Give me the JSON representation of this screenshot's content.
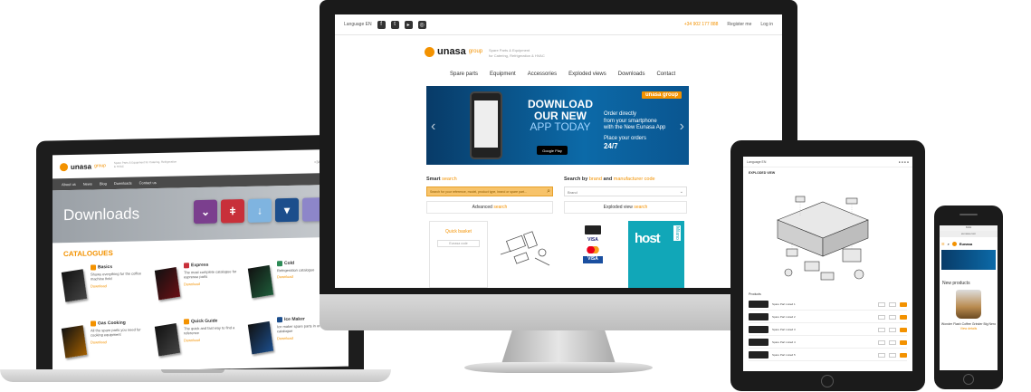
{
  "laptop": {
    "logo_word": "unasa",
    "logo_group": "group",
    "tagline": "Spare Parts & Equipment for Catering, Refrigeration & HVAC",
    "phone": "+34 902 177 888",
    "nav": [
      "About us",
      "News",
      "Blog",
      "Downloads",
      "Contact us"
    ],
    "hero_title": "Downloads",
    "catalogues_title": "CATALOGUES",
    "catalogues": [
      {
        "name": "Basics",
        "text": "Shows everything for the coffee machine field",
        "link": "Download"
      },
      {
        "name": "Express",
        "text": "The most complete catalogue for espresso parts",
        "link": "Download"
      },
      {
        "name": "Cold",
        "text": "Refrigeration catalogue",
        "link": "Download"
      },
      {
        "name": "Gas Cooking",
        "text": "All the spare parts you need for cooking equipment",
        "link": "Download"
      },
      {
        "name": "Quick Guide",
        "text": "The quick and fast way to find a reference",
        "link": "Download"
      },
      {
        "name": "Ice Maker",
        "text": "Ice maker spare parts in one catalogue",
        "link": "Download"
      }
    ]
  },
  "desktop": {
    "language": "Language EN",
    "phone": "+34 902 177 888",
    "register": "Register me",
    "login": "Log in",
    "logo_word": "unasa",
    "logo_group": "group",
    "tagline_1": "Spare Parts & Equipment",
    "tagline_2": "for Catering, Refrigeration & HVAC",
    "menu": [
      "Spare parts",
      "Equipment",
      "Accessories",
      "Exploded views",
      "Downloads",
      "Contact"
    ],
    "hero": {
      "line1": "DOWNLOAD",
      "line2": "OUR NEW",
      "line3": "APP TODAY",
      "store": "Google Play",
      "order_1": "Order directly",
      "order_2": "from your smartphone",
      "order_3": "with the New Eunasa App",
      "order_4": "Place your orders",
      "order_5": "24/7",
      "brand": "unasa group"
    },
    "smart_search_label": "Smart",
    "smart_search_orange": "search",
    "smart_search_placeholder": "Search for your reference, model, product type, brand or spare part...",
    "brand_search_label": "Search by",
    "brand_search_brand": "brand",
    "brand_search_and": "and",
    "brand_search_ref": "manufacturer code",
    "brand_select": "Brand",
    "advanced_label": "Advanced",
    "advanced_orange": "search",
    "exploded_label": "Exploded view",
    "exploded_orange": "search",
    "basket_title": "Quick basket",
    "basket_input": "Eunasa code",
    "pay_visa": "VISA",
    "pay_visa2": "VISA",
    "host_word": "host",
    "host_city": "Milano"
  },
  "tablet": {
    "language": "Language EN",
    "title": "EXPLODED VIEW",
    "products_label": "Products",
    "rows": [
      "Spare Part Listed 1",
      "Spare Part Listed 2",
      "Spare Part Listed 3",
      "Spare Part Listed 4",
      "Spare Part Listed 5"
    ]
  },
  "phone": {
    "time": "9:41",
    "url": "eunasa.com",
    "logo_word": "Eunasa",
    "new_products": "New products",
    "product_name": "Wonder Flash Coffee Grinder Big Nero",
    "product_price": "View details"
  },
  "colors": {
    "accent": "#f39200",
    "hero_blue": "#0c6aa8",
    "host_teal": "#11a7b8",
    "device_black": "#1b1b1b"
  }
}
